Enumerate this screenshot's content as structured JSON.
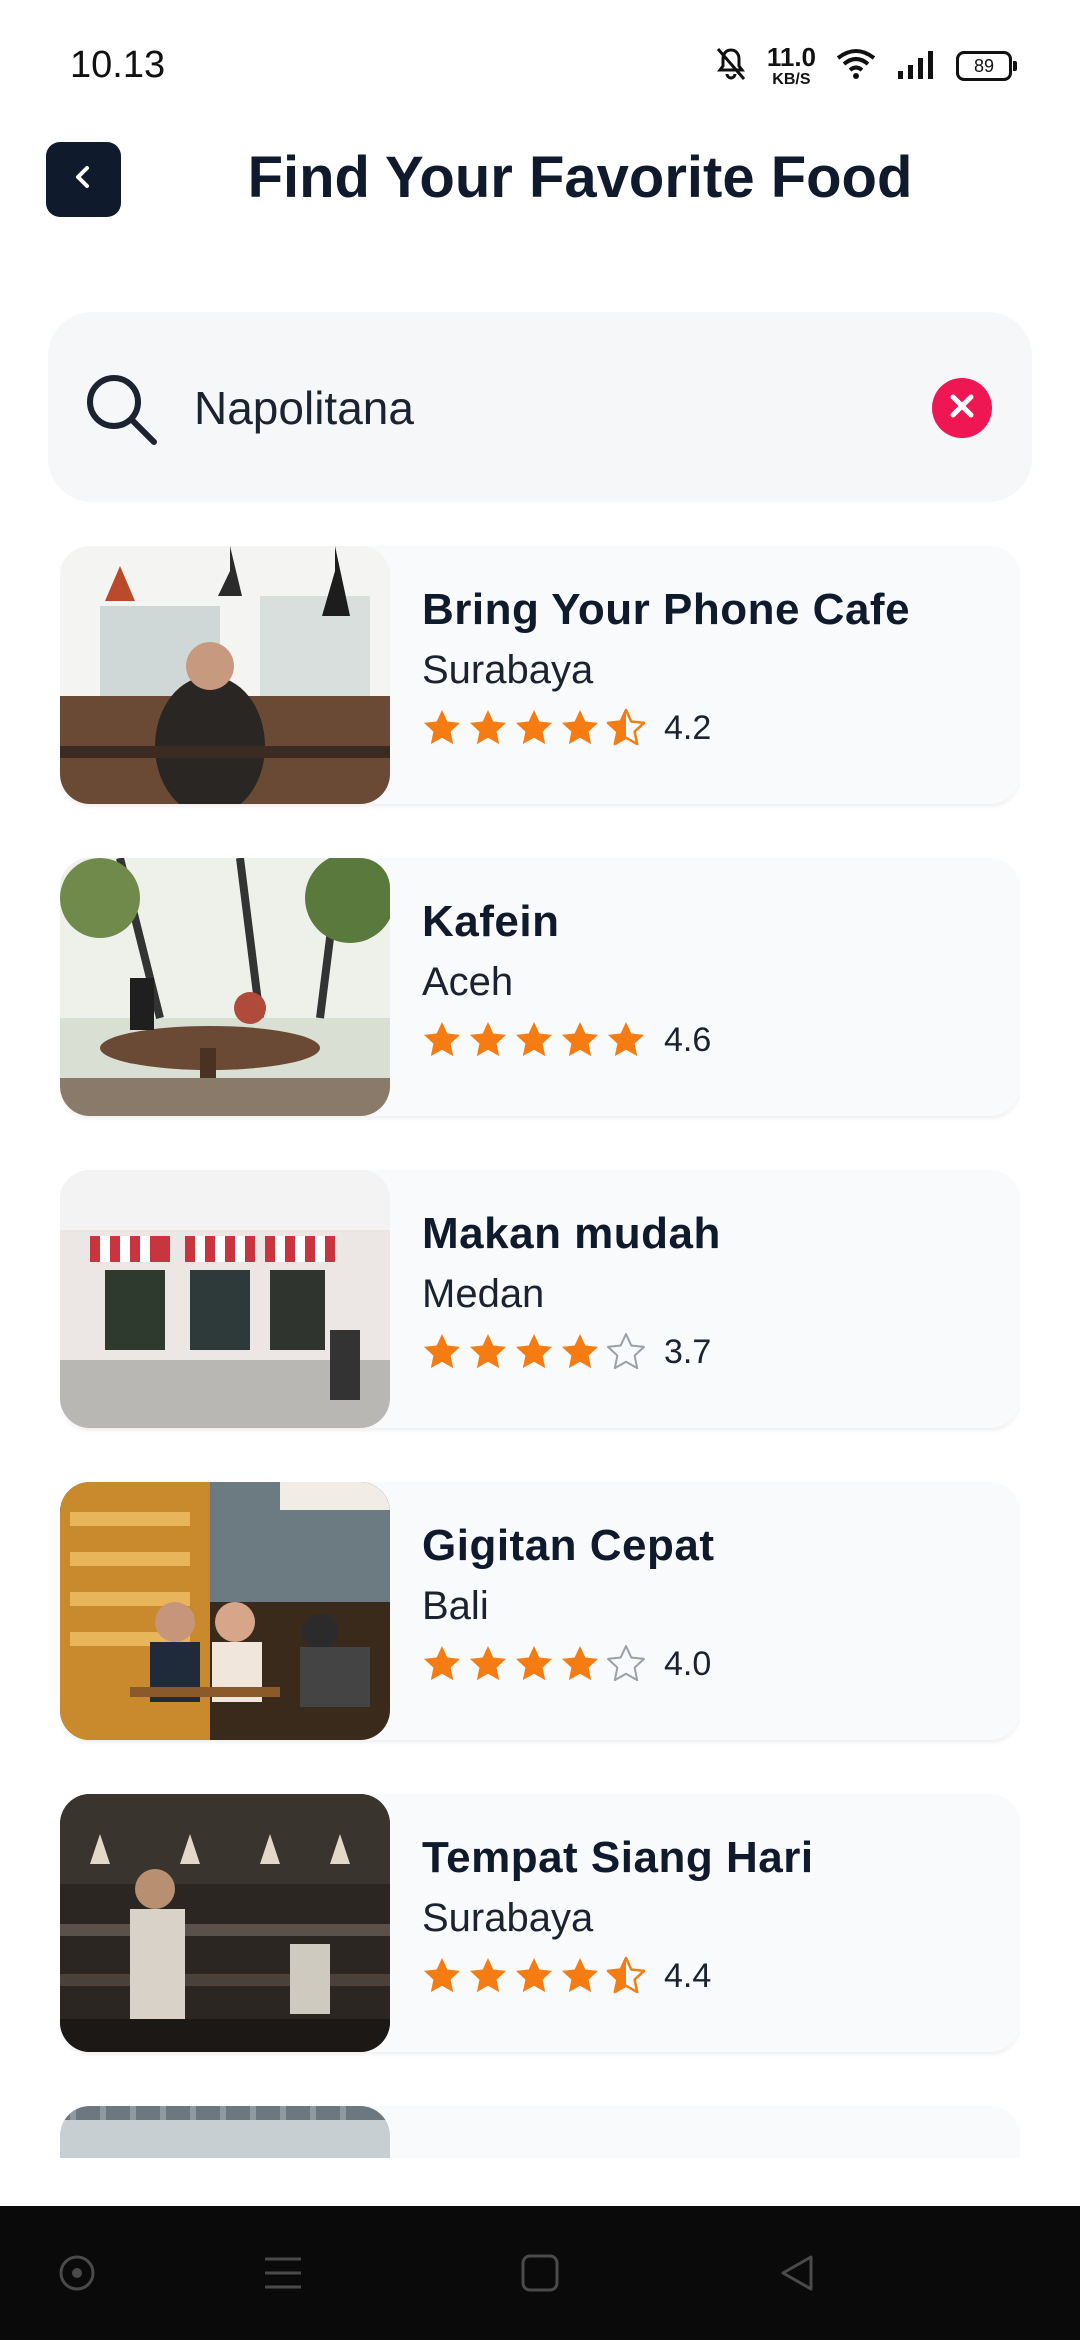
{
  "status_bar": {
    "time": "10.13",
    "net_speed_value": "11.0",
    "net_speed_unit": "KB/S",
    "battery_level": "89"
  },
  "header": {
    "title": "Find Your Favorite Food",
    "back_icon": "chevron-left-icon"
  },
  "search": {
    "value": "Napolitana",
    "placeholder": "",
    "search_icon": "search-icon",
    "clear_icon": "close-icon"
  },
  "colors": {
    "accent_dark": "#0f1b2d",
    "star": "#f47c12",
    "clear": "#ef1654",
    "card_bg": "#f9fafc",
    "search_bg": "#f6f7f9"
  },
  "restaurants": [
    {
      "name": "Bring Your Phone Cafe",
      "city": "Surabaya",
      "rating": "4.2",
      "stars": 4.5
    },
    {
      "name": "Kafein",
      "city": "Aceh",
      "rating": "4.6",
      "stars": 5
    },
    {
      "name": "Makan mudah",
      "city": "Medan",
      "rating": "3.7",
      "stars": 4
    },
    {
      "name": "Gigitan Cepat",
      "city": "Bali",
      "rating": "4.0",
      "stars": 4
    },
    {
      "name": "Tempat Siang Hari",
      "city": "Surabaya",
      "rating": "4.4",
      "stars": 4.5
    },
    {
      "name": "",
      "city": "",
      "rating": "",
      "stars": 0
    }
  ],
  "nav_bar": {
    "items": [
      "recent-apps-dot-icon",
      "menu-icon",
      "home-square-icon",
      "back-triangle-icon"
    ]
  }
}
